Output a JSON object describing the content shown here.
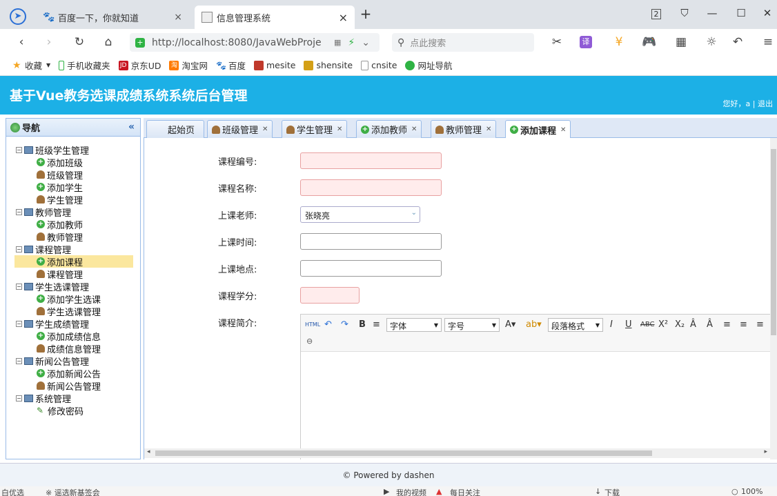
{
  "browser": {
    "tabs": [
      {
        "label": "百度一下，你就知道"
      },
      {
        "label": "信息管理系统"
      }
    ],
    "tab_count": "2",
    "url": "http://localhost:8080/JavaWebProje",
    "search_placeholder": "点此搜索"
  },
  "bookmarks": [
    "收藏",
    "手机收藏夹",
    "京东UD",
    "淘宝网",
    "百度",
    "mesite",
    "shensite",
    "cnsite",
    "网址导航"
  ],
  "app": {
    "title": "基于Vue教务选课成绩系统系统后台管理",
    "welcome": "您好，a | 退出",
    "footer": "© Powered by dashen"
  },
  "nav": {
    "title": "导航",
    "groups": [
      {
        "label": "班级学生管理",
        "items": [
          {
            "label": "添加班级",
            "icon": "plus"
          },
          {
            "label": "班级管理",
            "icon": "user"
          },
          {
            "label": "添加学生",
            "icon": "plus"
          },
          {
            "label": "学生管理",
            "icon": "user"
          }
        ]
      },
      {
        "label": "教师管理",
        "items": [
          {
            "label": "添加教师",
            "icon": "plus"
          },
          {
            "label": "教师管理",
            "icon": "user"
          }
        ]
      },
      {
        "label": "课程管理",
        "items": [
          {
            "label": "添加课程",
            "icon": "plus",
            "selected": true
          },
          {
            "label": "课程管理",
            "icon": "user"
          }
        ]
      },
      {
        "label": "学生选课管理",
        "items": [
          {
            "label": "添加学生选课",
            "icon": "plus"
          },
          {
            "label": "学生选课管理",
            "icon": "user"
          }
        ]
      },
      {
        "label": "学生成绩管理",
        "items": [
          {
            "label": "添加成绩信息",
            "icon": "plus"
          },
          {
            "label": "成绩信息管理",
            "icon": "user"
          }
        ]
      },
      {
        "label": "新闻公告管理",
        "items": [
          {
            "label": "添加新闻公告",
            "icon": "plus"
          },
          {
            "label": "新闻公告管理",
            "icon": "user"
          }
        ]
      },
      {
        "label": "系统管理",
        "items": [
          {
            "label": "修改密码",
            "icon": "pen"
          }
        ]
      }
    ]
  },
  "tabs": [
    {
      "label": "起始页",
      "closable": false
    },
    {
      "label": "班级管理",
      "closable": true
    },
    {
      "label": "学生管理",
      "closable": true
    },
    {
      "label": "添加教师",
      "closable": true
    },
    {
      "label": "教师管理",
      "closable": true
    },
    {
      "label": "添加课程",
      "closable": true,
      "active": true
    }
  ],
  "form": {
    "course_no_label": "课程编号:",
    "course_name_label": "课程名称:",
    "teacher_label": "上课老师:",
    "teacher_value": "张晓亮",
    "time_label": "上课时间:",
    "place_label": "上课地点:",
    "credit_label": "课程学分:",
    "intro_label": "课程简介:"
  },
  "editor": {
    "font_family": "字体",
    "font_size": "字号",
    "paragraph": "段落格式",
    "html_label": "HTML"
  },
  "statusbar": {
    "left1": "白优选",
    "left2": "※ 谣选新基签会",
    "video": "我的视频",
    "daily": "每日关注",
    "download": "下载",
    "zoom": "100%"
  }
}
